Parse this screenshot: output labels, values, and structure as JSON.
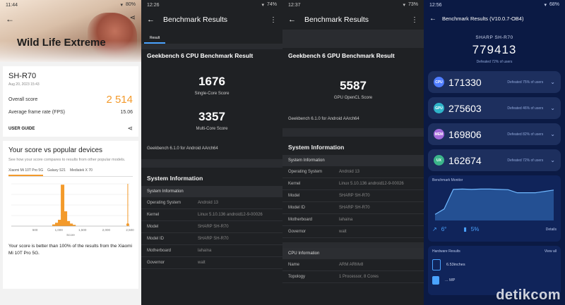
{
  "p1": {
    "time": "11:44",
    "battery": "80%",
    "hero_title": "Wild Life Extreme",
    "device": "SH-R70",
    "date": "Aug 20, 2023 15:43",
    "overall_label": "Overall score",
    "overall_value": "2 514",
    "fps_label": "Average frame rate (FPS)",
    "fps_value": "15.06",
    "user_guide": "USER GUIDE",
    "popular_title": "Your score vs popular devices",
    "popular_desc": "See how your score compares to results from other popular models.",
    "tabs": [
      "Xiaomi Mi 10T Pro 5G",
      "Galaxy S21",
      "Mediatek X 70"
    ],
    "chart_data": {
      "type": "bar",
      "title": "",
      "x_ticks": [
        "500",
        "1,000",
        "1,500",
        "2,000",
        "2,500"
      ],
      "x_range": [
        0,
        2500
      ],
      "xlabel": "Score",
      "bins": [
        {
          "x": 900,
          "v": 0.04
        },
        {
          "x": 960,
          "v": 0.08
        },
        {
          "x": 1020,
          "v": 0.15
        },
        {
          "x": 1080,
          "v": 0.98
        },
        {
          "x": 1140,
          "v": 0.35
        },
        {
          "x": 1200,
          "v": 0.12
        },
        {
          "x": 1260,
          "v": 0.06
        },
        {
          "x": 1320,
          "v": 0.03
        }
      ],
      "your_score": 2514
    },
    "result_text": "Your score is better than 100% of the results from the Xiaomi Mi 10T Pro 5G."
  },
  "p2": {
    "time": "12:26",
    "battery": "74%",
    "title": "Benchmark Results",
    "tab": "Result",
    "heading": "Geekbench 6 CPU Benchmark Result",
    "single_score": "1676",
    "single_label": "Single-Core Score",
    "multi_score": "3357",
    "multi_label": "Multi-Core Score",
    "version": "Geekbench 6.1.0 for Android AArch64",
    "sys_title": "System Information",
    "sys_header": "System Information",
    "rows": [
      {
        "k": "Operating System",
        "v": "Android 13"
      },
      {
        "k": "Kernel",
        "v": "Linux 5.10.136 android12-9-00026"
      },
      {
        "k": "Model",
        "v": "SHARP SH-R70"
      },
      {
        "k": "Model ID",
        "v": "SHARP SH-R70"
      },
      {
        "k": "Motherboard",
        "v": "lahaina"
      },
      {
        "k": "Governor",
        "v": "walt"
      }
    ]
  },
  "p3": {
    "time": "12:37",
    "battery": "73%",
    "title": "Benchmark Results",
    "heading": "Geekbench 6 GPU Benchmark Result",
    "score": "5587",
    "score_label": "GPU OpenCL Score",
    "version": "Geekbench 6.1.0 for Android AArch64",
    "sys_title": "System Information",
    "sys_header": "System Information",
    "rows": [
      {
        "k": "Operating System",
        "v": "Android 13"
      },
      {
        "k": "Kernel",
        "v": "Linux 5.10.136 android12-9-00026"
      },
      {
        "k": "Model",
        "v": "SHARP SH-R70"
      },
      {
        "k": "Model ID",
        "v": "SHARP SH-R70"
      },
      {
        "k": "Motherboard",
        "v": "lahaina"
      },
      {
        "k": "Governor",
        "v": "walt"
      }
    ],
    "cpu_header": "CPU Information",
    "cpu_rows": [
      {
        "k": "Name",
        "v": "ARM ARMv8"
      },
      {
        "k": "Topology",
        "v": "1 Processor, 8 Cores"
      }
    ]
  },
  "p4": {
    "time": "12:56",
    "battery": "68%",
    "title": "Benchmark Results (V10.0.7-OB4)",
    "device": "SHARP SH-R70",
    "total": "779413",
    "total_note": "Defeated 72% of users",
    "scores": [
      {
        "icon": "CPU",
        "value": "171330",
        "note": "Defeated 75% of users",
        "color": "#4f7dff"
      },
      {
        "icon": "GPU",
        "value": "275603",
        "note": "Defeated 46% of users",
        "color": "#2fb4c9"
      },
      {
        "icon": "MEM",
        "value": "169806",
        "note": "Defeated 82% of users",
        "color": "#a36bdc"
      },
      {
        "icon": "UX",
        "value": "162674",
        "note": "Defeated 72% of users",
        "color": "#3bb58a"
      }
    ],
    "monitor_label": "Benchmark Monitor",
    "chart_data": {
      "type": "line",
      "title": "",
      "series": [
        {
          "values": [
            0.18,
            0.34,
            0.92,
            0.93,
            0.92,
            0.93,
            0.93,
            0.92,
            0.91,
            0.82,
            0.82,
            0.82,
            0.86,
            0.9
          ]
        }
      ]
    },
    "temp_rise": "6°",
    "battery_drop": "5%",
    "details": "Details",
    "hw_label": "Hardware Results",
    "view_all": "View all",
    "hw_value1": "6.53inches",
    "hw_value2": "... MP"
  },
  "watermark": "detikcom"
}
